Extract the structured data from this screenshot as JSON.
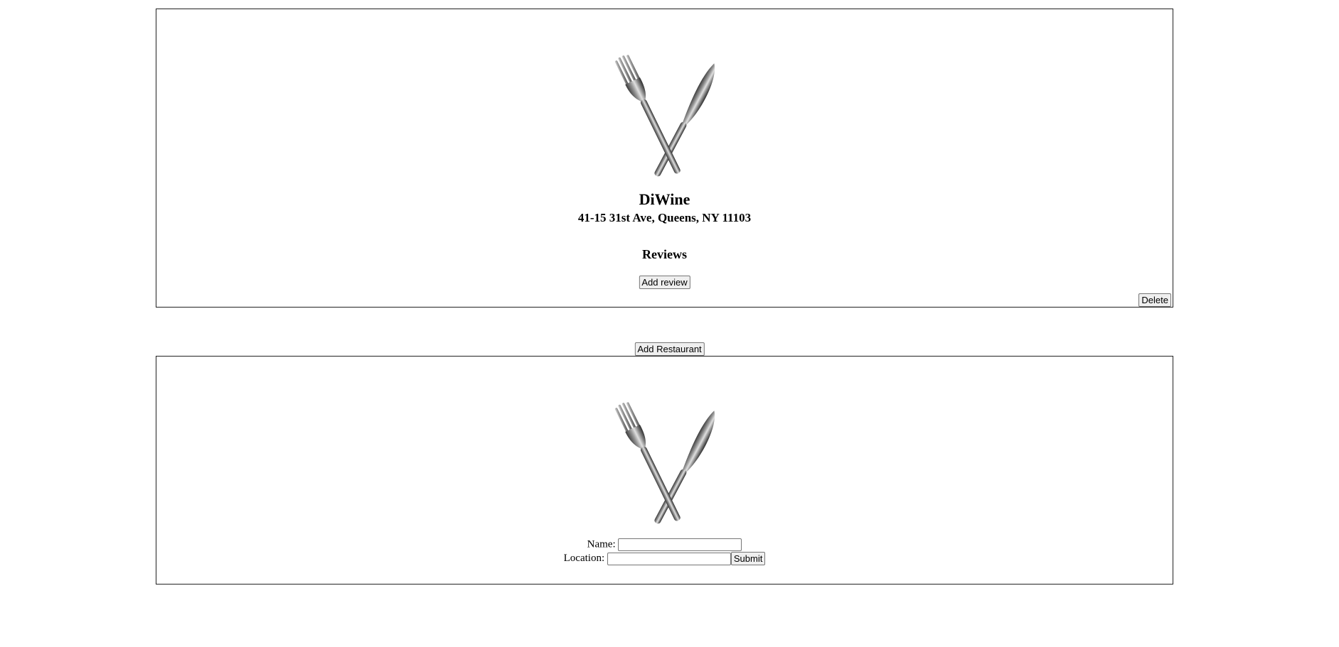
{
  "restaurant": {
    "name": "DiWine",
    "address": "41-15 31st Ave, Queens, NY 11103",
    "reviews_heading": "Reviews",
    "add_review_label": "Add review",
    "delete_label": "Delete",
    "logo_icon": "fork-knife-icon"
  },
  "add_restaurant_label": "Add Restaurant",
  "new_restaurant_form": {
    "logo_icon": "fork-knife-icon",
    "name_label": "Name:",
    "name_value": "",
    "location_label": "Location:",
    "location_value": "",
    "submit_label": "Submit"
  }
}
